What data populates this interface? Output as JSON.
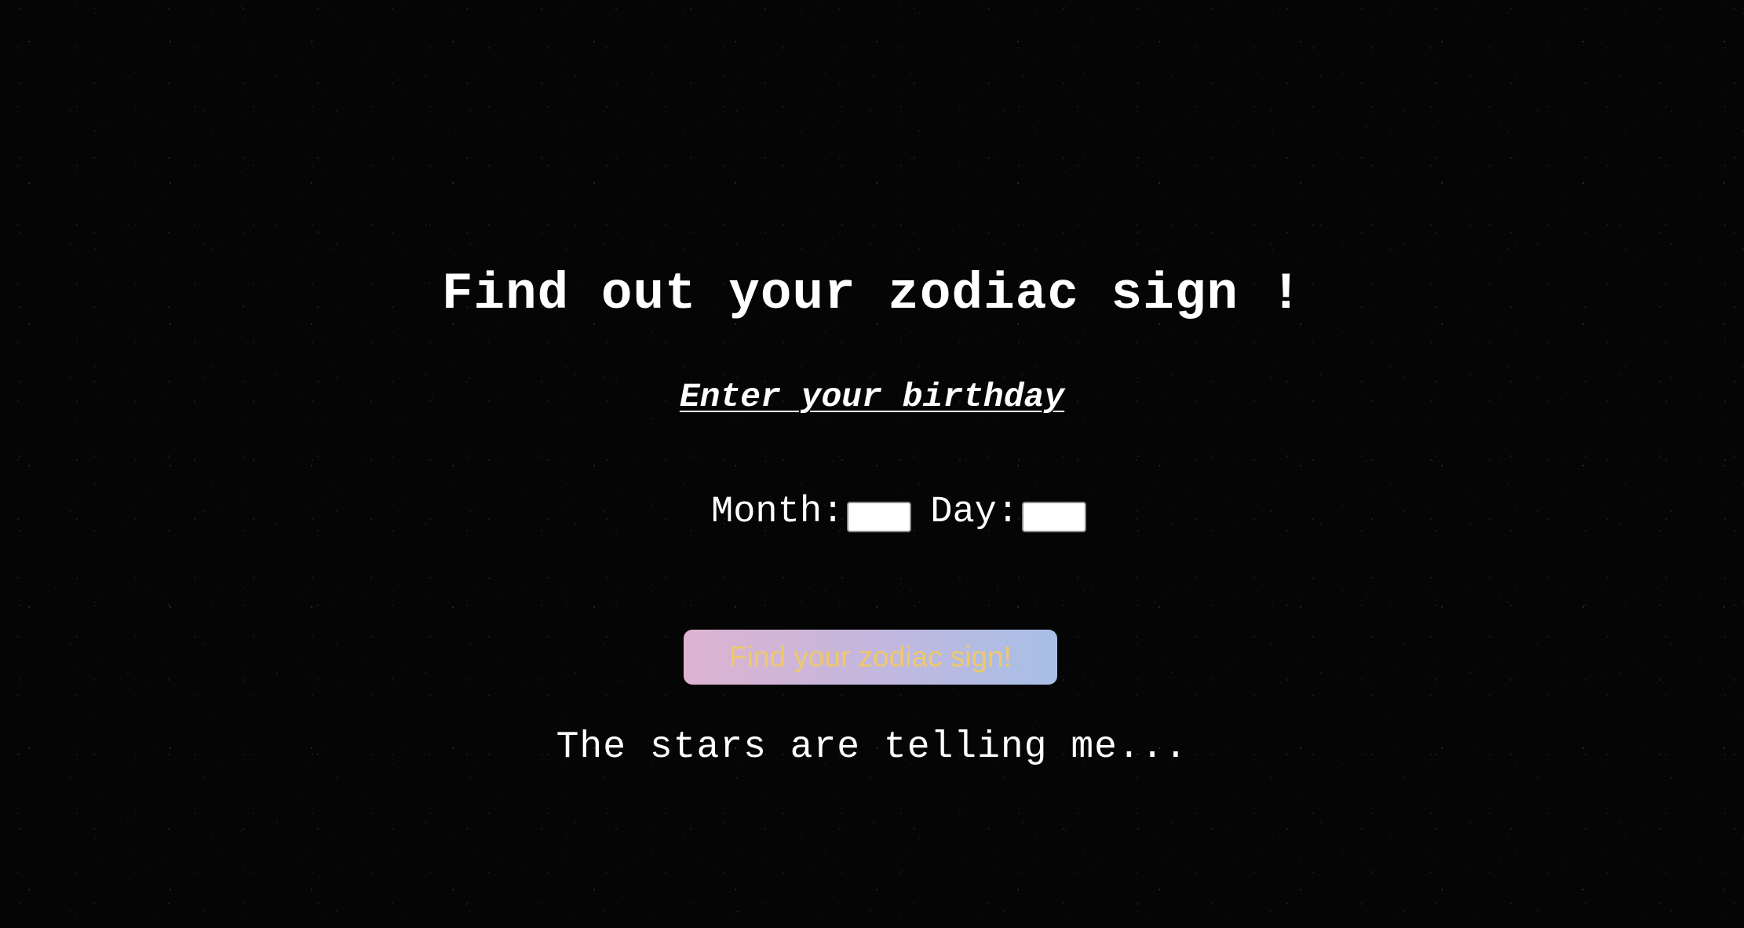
{
  "page": {
    "title": "Find out your zodiac sign !",
    "subtitle": "Enter your birthday",
    "background_color": "#000000"
  },
  "form": {
    "month_label": "Month:",
    "month_value": "",
    "day_label": "Day:",
    "day_value": "",
    "submit_label": "Find your zodiac sign!",
    "submit_text_color": "#efc96a",
    "submit_gradient": [
      "#ddb3d0",
      "#a7bfe6"
    ]
  },
  "result": {
    "text": "The stars are telling me..."
  }
}
